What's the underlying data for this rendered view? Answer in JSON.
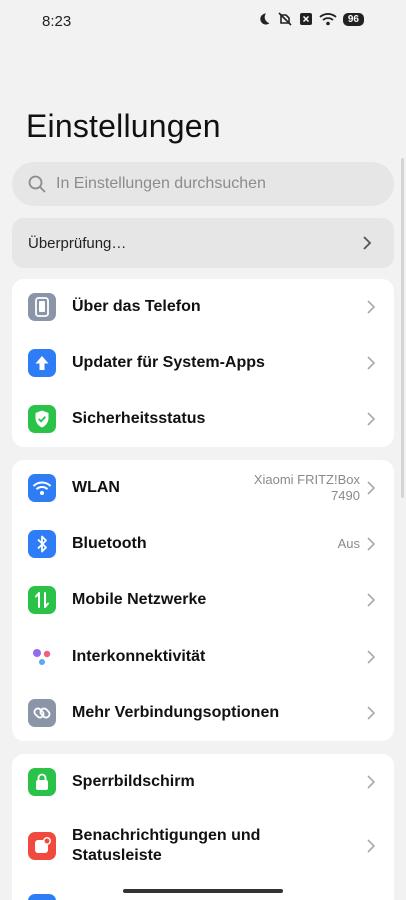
{
  "status_bar": {
    "time": "8:23",
    "battery": "96",
    "icons": [
      "moon-icon",
      "mute-vibrate-icon",
      "sim-x-icon",
      "wifi-icon",
      "battery-icon"
    ]
  },
  "page": {
    "title": "Einstellungen"
  },
  "search": {
    "placeholder": "In Einstellungen durchsuchen"
  },
  "review": {
    "label": "Überprüfung…"
  },
  "sections": [
    {
      "items": [
        {
          "label": "Über das Telefon",
          "icon": "phone-icon",
          "color": "#8a96a8"
        },
        {
          "label": "Updater für System-Apps",
          "icon": "arrow-up-icon",
          "color": "#2f7df6"
        },
        {
          "label": "Sicherheitsstatus",
          "icon": "shield-check-icon",
          "color": "#2bc24a"
        }
      ]
    },
    {
      "items": [
        {
          "label": "WLAN",
          "value": "Xiaomi FRITZ!Box 7490",
          "value_line1": "Xiaomi FRITZ!Box",
          "value_line2": "7490",
          "icon": "wifi-icon",
          "color": "#2f7df6"
        },
        {
          "label": "Bluetooth",
          "value": "Aus",
          "icon": "bluetooth-icon",
          "color": "#2f7df6"
        },
        {
          "label": "Mobile Netzwerke",
          "icon": "mobile-data-icon",
          "color": "#2bc24a"
        },
        {
          "label": "Interkonnektivität",
          "icon": "interconnect-icon",
          "color": "#8f6cf0"
        },
        {
          "label": "Mehr Verbindungsoptionen",
          "icon": "link-icon",
          "color": "#8a96a8"
        }
      ]
    },
    {
      "items": [
        {
          "label": "Sperrbildschirm",
          "icon": "lock-icon",
          "color": "#2bc24a"
        },
        {
          "label": "Benachrichtigungen und Statusleiste",
          "label_line1": "Benachrichtigungen und",
          "label_line2": "Statusleiste",
          "icon": "notification-icon",
          "color": "#f04a3e"
        }
      ]
    }
  ]
}
